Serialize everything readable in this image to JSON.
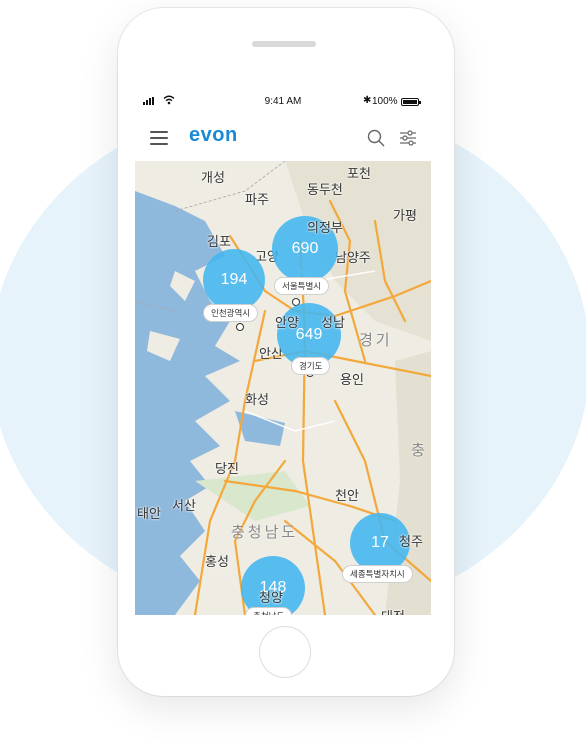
{
  "status": {
    "time": "9:41 AM",
    "battery": "100%",
    "bluetooth": "✱"
  },
  "app": {
    "logo": "evon",
    "menu_icon": "menu-icon",
    "search_icon": "search-icon",
    "filter_icon": "filter-icon"
  },
  "clusters": [
    {
      "count": "194",
      "region": "인천광역시"
    },
    {
      "count": "690",
      "region": "서울특별시"
    },
    {
      "count": "649",
      "region": "경기도"
    },
    {
      "count": "17",
      "region": "세종특별자치시"
    },
    {
      "count": "148",
      "region": "충청남도"
    }
  ],
  "places": {
    "kaesong": "개성",
    "pocheon": "포천",
    "paju": "파주",
    "dongducheon": "동두천",
    "gapyeong": "가평",
    "uijeongbu": "의정부",
    "gimpo": "김포",
    "goyang": "고양",
    "namyangju": "남양주",
    "seongnam": "성남",
    "anyang": "안양",
    "ansan": "안산",
    "yongin": "용인",
    "hwaseong": "화성",
    "dangjin": "당진",
    "seosan": "서산",
    "taean": "태안",
    "cheonan": "천안",
    "hongseong": "홍성",
    "cheongyang": "청양",
    "cheongju": "청주",
    "daejeon": "대전",
    "gyeonggi": "경기",
    "chung": "충",
    "chungnam": "충청남도"
  }
}
